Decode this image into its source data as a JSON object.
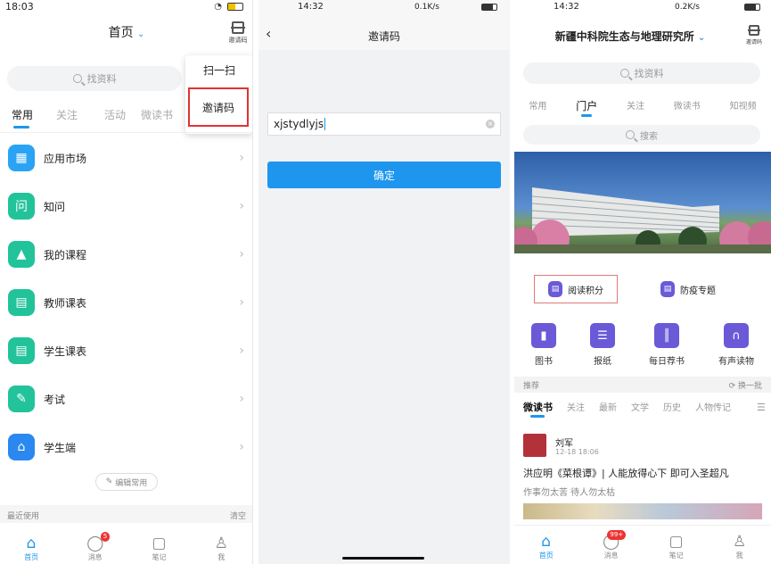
{
  "panel1": {
    "status": {
      "time": "18:03"
    },
    "title": "首页",
    "scan_label": "邀请码",
    "search_placeholder": "找资料",
    "tabs": [
      "常用",
      "关注",
      "活动",
      "微读书"
    ],
    "popup": {
      "scan": "扫一扫",
      "invite": "邀请码"
    },
    "items": [
      {
        "label": "应用市场",
        "icon": "apps-icon",
        "color": "#2aa3f5"
      },
      {
        "label": "知问",
        "icon": "qa-icon",
        "color": "#22c39a"
      },
      {
        "label": "我的课程",
        "icon": "graduation-cap-icon",
        "color": "#22c39a"
      },
      {
        "label": "教师课表",
        "icon": "calendar-icon",
        "color": "#22c39a"
      },
      {
        "label": "学生课表",
        "icon": "calendar-icon",
        "color": "#22c39a"
      },
      {
        "label": "考试",
        "icon": "exam-icon",
        "color": "#22c39a"
      },
      {
        "label": "学生端",
        "icon": "home-icon",
        "color": "#2a88f0"
      }
    ],
    "edit_button": "编辑常用",
    "recent": "最近使用",
    "clear": "清空",
    "tabbar": [
      {
        "label": "首页",
        "icon": "home-icon",
        "active": true
      },
      {
        "label": "消息",
        "icon": "chat-icon",
        "badge": "5"
      },
      {
        "label": "笔记",
        "icon": "note-icon"
      },
      {
        "label": "我",
        "icon": "person-icon"
      }
    ]
  },
  "panel2": {
    "status": {
      "time": "14:32",
      "net": "0.1K/s"
    },
    "title": "邀请码",
    "input_value": "xjstydlyjs",
    "confirm": "确定"
  },
  "panel3": {
    "status": {
      "time": "14:32",
      "net": "0.2K/s"
    },
    "title": "新疆中科院生态与地理研究所",
    "scan_label": "邀请码",
    "search_placeholder": "找资料",
    "tabs": [
      "常用",
      "门户",
      "关注",
      "微读书",
      "知视频"
    ],
    "inner_search": "搜索",
    "features": [
      "阅读积分",
      "防疫专题"
    ],
    "grid": [
      {
        "label": "图书",
        "icon": "book-icon"
      },
      {
        "label": "报纸",
        "icon": "newspaper-icon"
      },
      {
        "label": "每日荐书",
        "icon": "books-icon"
      },
      {
        "label": "有声读物",
        "icon": "headphones-icon"
      }
    ],
    "recommend": "推荐",
    "refresh": "换一批",
    "tabs2": [
      "微读书",
      "关注",
      "最新",
      "文学",
      "历史",
      "人物传记"
    ],
    "post": {
      "author": "刘军",
      "time": "12-18 18:06",
      "title": "洪应明《菜根谭》| 人能放得心下 即可入圣超凡",
      "subtitle": "作事勿太苦 待人勿太枯"
    },
    "tabbar": [
      {
        "label": "首页",
        "icon": "home-icon",
        "active": true
      },
      {
        "label": "消息",
        "icon": "chat-icon",
        "badge": "99+"
      },
      {
        "label": "笔记",
        "icon": "note-icon"
      },
      {
        "label": "我",
        "icon": "person-icon"
      }
    ]
  },
  "colors": {
    "accent": "#1e96ee",
    "highlight_border": "#e03333",
    "purple": "#6a5ad7"
  }
}
